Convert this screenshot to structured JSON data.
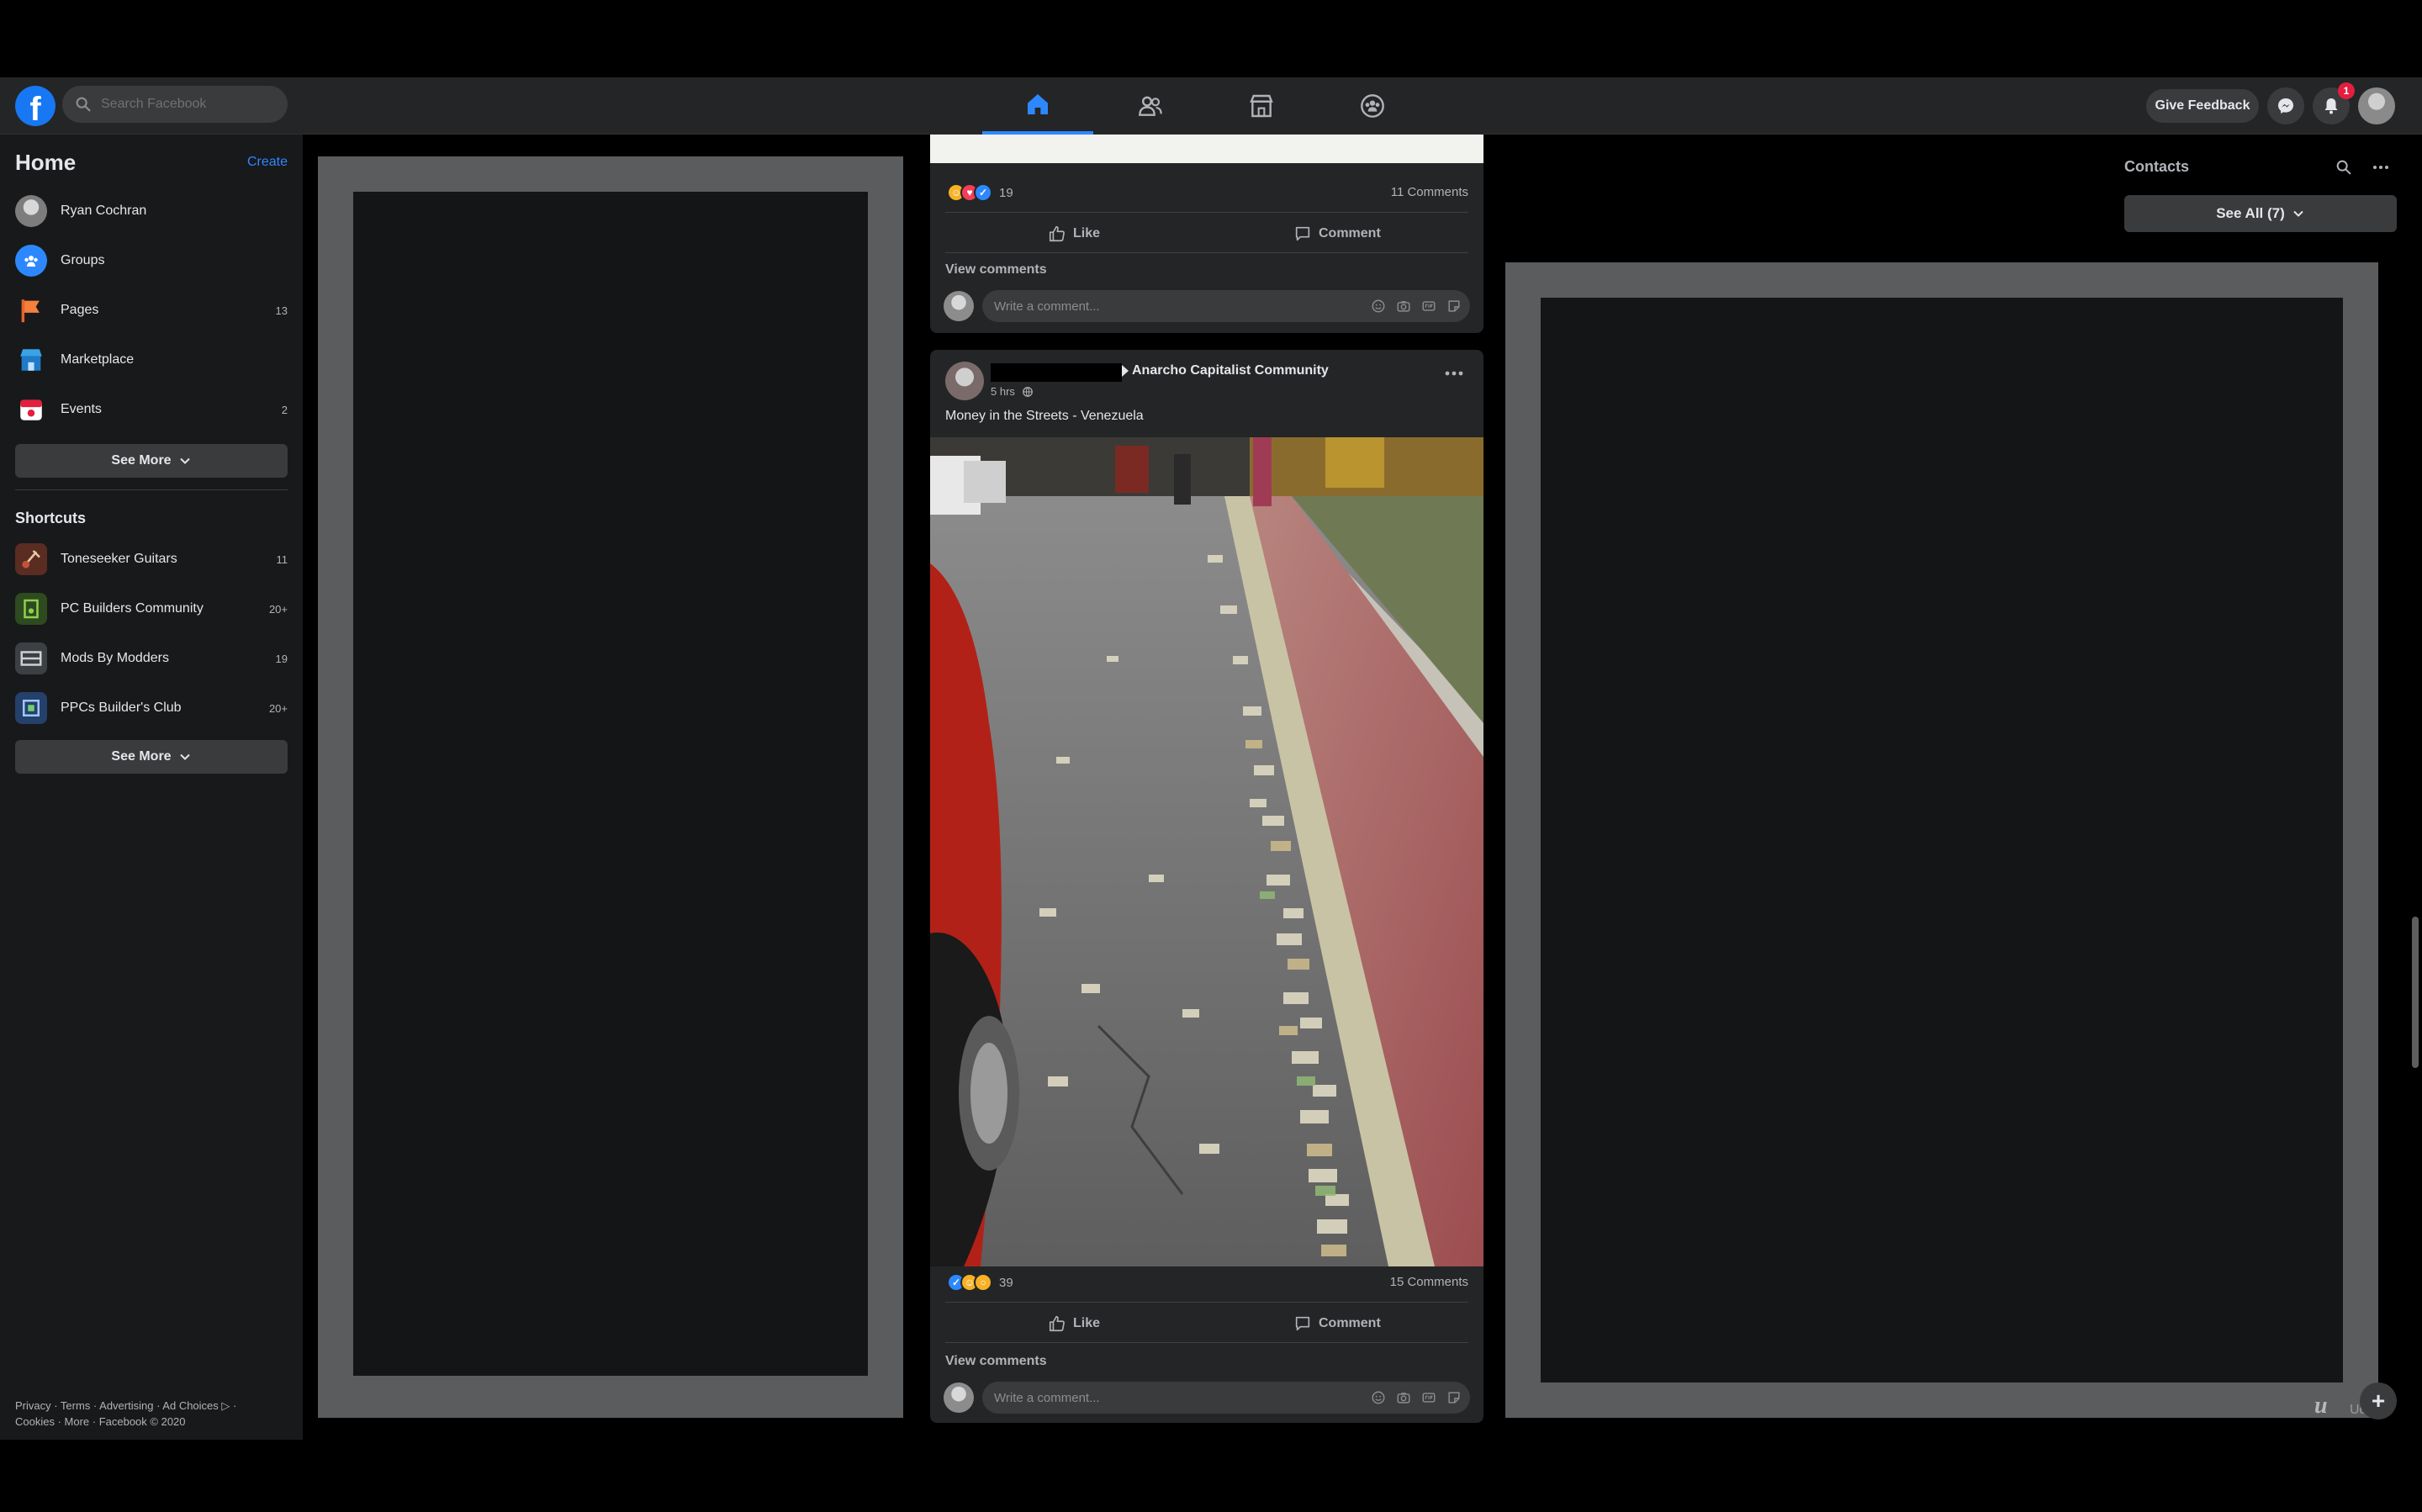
{
  "topbar": {
    "logo": "f",
    "search_placeholder": "Search Facebook",
    "nav_tabs": [
      {
        "name": "home",
        "icon": "home-icon",
        "active": true
      },
      {
        "name": "friends",
        "icon": "friends-icon",
        "active": false
      },
      {
        "name": "marketplace",
        "icon": "marketplace-icon",
        "active": false
      },
      {
        "name": "groups",
        "icon": "groups-icon",
        "active": false
      }
    ],
    "feedback_label": "Give Feedback",
    "notification_count": "1"
  },
  "sidebar": {
    "title": "Home",
    "create_label": "Create",
    "items": [
      {
        "label": "Ryan Cochran",
        "count": "",
        "icon": "profile-avatar"
      },
      {
        "label": "Groups",
        "count": "",
        "icon": "groups-icon"
      },
      {
        "label": "Pages",
        "count": "13",
        "icon": "flag-icon"
      },
      {
        "label": "Marketplace",
        "count": "",
        "icon": "shop-icon"
      },
      {
        "label": "Events",
        "count": "2",
        "icon": "calendar-icon"
      }
    ],
    "see_more_label": "See More",
    "shortcuts_title": "Shortcuts",
    "shortcuts": [
      {
        "label": "Toneseeker Guitars",
        "count": "11"
      },
      {
        "label": "PC Builders Community",
        "count": "20+"
      },
      {
        "label": "Mods By Modders",
        "count": "19"
      },
      {
        "label": "PPCs Builder's Club",
        "count": "20+"
      }
    ],
    "shortcuts_see_more_label": "See More",
    "footer_line1": "Privacy · Terms · Advertising · Ad Choices ▷ ·",
    "footer_line2": "Cookies · More · Facebook © 2020"
  },
  "feed": {
    "post_a": {
      "reaction_count": "19",
      "comment_count": "11 Comments",
      "like_label": "Like",
      "comment_label": "Comment",
      "view_comments_label": "View comments",
      "comment_placeholder": "Write a comment..."
    },
    "post_b": {
      "group_name": "Anarcho Capitalist Community",
      "time": "5 hrs",
      "text": "Money in the Streets - Venezuela",
      "reaction_count": "39",
      "comment_count": "15 Comments",
      "like_label": "Like",
      "comment_label": "Comment",
      "view_comments_label": "View comments",
      "comment_placeholder": "Write a comment..."
    }
  },
  "contacts": {
    "title": "Contacts",
    "see_all_label": "See All (7)"
  },
  "watermark": {
    "mark": "u",
    "text": "Udemy"
  },
  "colors": {
    "accent": "#2d88ff",
    "surface": "#242526",
    "background": "#18191a",
    "badge": "#e41e3f"
  }
}
